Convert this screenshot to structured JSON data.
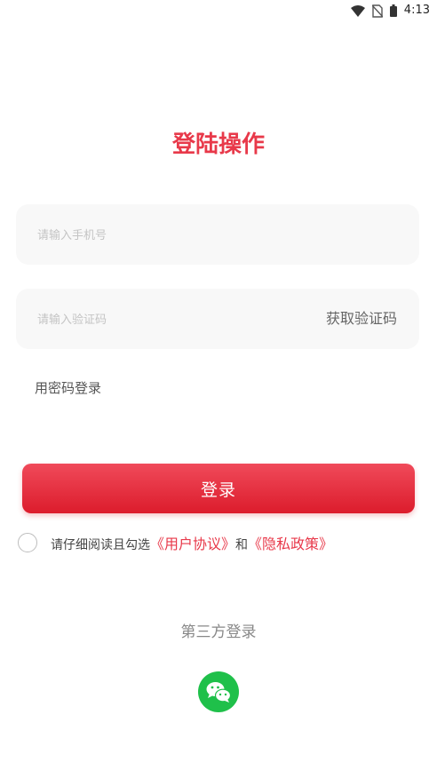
{
  "status_bar": {
    "time": "4:13"
  },
  "page": {
    "title": "登陆操作"
  },
  "form": {
    "phone_placeholder": "请输入手机号",
    "code_placeholder": "请输入验证码",
    "get_code_label": "获取验证码",
    "password_login_label": "用密码登录",
    "login_button_label": "登录"
  },
  "agreement": {
    "prefix": "请仔细阅读且勾选",
    "user_agreement": "《用户协议》",
    "and": "和",
    "privacy_policy": "《隐私政策》"
  },
  "third_party": {
    "title": "第三方登录",
    "providers": [
      {
        "icon": "wechat-icon",
        "color": "#1fc04a"
      }
    ]
  },
  "colors": {
    "accent": "#e8394a",
    "button_top": "#f04a5a",
    "button_bottom": "#dc1c2c"
  }
}
